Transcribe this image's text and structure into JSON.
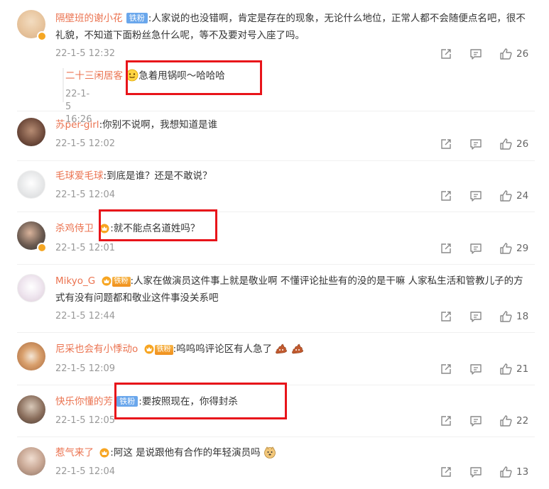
{
  "badges": {
    "fan": "铁粉"
  },
  "comments": [
    {
      "username": "隔壁班的谢小花",
      "text": ":人家说的也没错啊，肯定是存在的现象，无论什么地位，正常人都不会随便点名吧，很不礼貌，不知道下面粉丝急什么呢，等不及要对号入座了吗。",
      "time": "22-1-5 12:32",
      "likes": "26",
      "reply": {
        "username": "二十三闲居客",
        "text": "急着甩锅呗～哈哈哈",
        "time": "22-1-5 16:26"
      }
    },
    {
      "username": "苏per-girl",
      "text": ":你别不说啊，我想知道是谁",
      "time": "22-1-5 12:02",
      "likes": "26"
    },
    {
      "username": "毛球爱毛球",
      "text": ":到底是谁？还是不敢说？",
      "time": "22-1-5 12:04",
      "likes": "24"
    },
    {
      "username": "杀鸡侍卫",
      "text": ":就不能点名道姓吗？",
      "time": "22-1-5 12:01",
      "likes": "29"
    },
    {
      "username": "Mikyo_G",
      "text": ":人家在做演员这件事上就是敬业啊 不懂评论扯些有的没的是干嘛 人家私生活和管教儿子的方式有没有问题都和敬业这件事没关系吧",
      "time": "22-1-5 12:44",
      "likes": "18"
    },
    {
      "username": "尼采也会有小悸动o",
      "text": ":呜呜呜评论区有人急了",
      "time": "22-1-5 12:09",
      "likes": "21"
    },
    {
      "username": "快乐你懂的芳",
      "text": ":要按照现在，你得封杀",
      "time": "22-1-5 12:05",
      "likes": "22"
    },
    {
      "username": "惹气来了",
      "text": ":阿这 是说跟他有合作的年轻演员吗",
      "time": "22-1-5 12:04",
      "likes": "13"
    }
  ],
  "colors": {
    "username": "#eb7350",
    "highlight_box": "#e8141a",
    "fan_badge": "#6aa7ec",
    "vip_badge": "#f5a623"
  }
}
